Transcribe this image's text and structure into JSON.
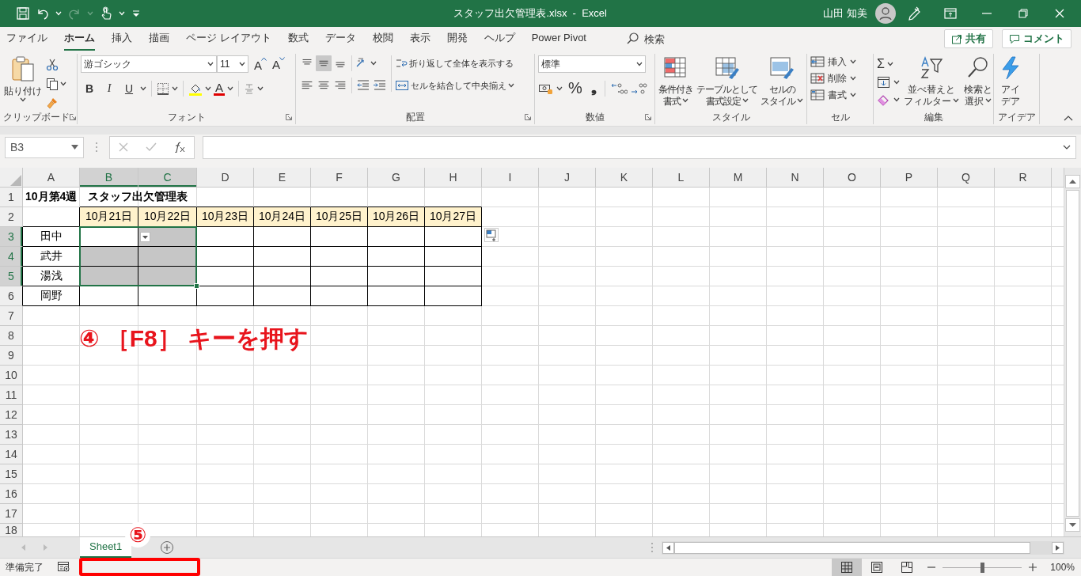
{
  "title_bar": {
    "title": "スタッフ出欠管理表.xlsx  -  Excel",
    "user": "山田 知美",
    "redo_disabled": true
  },
  "menu_tabs": [
    {
      "label": "ファイル",
      "selected": false
    },
    {
      "label": "ホーム",
      "selected": true
    },
    {
      "label": "挿入",
      "selected": false
    },
    {
      "label": "描画",
      "selected": false
    },
    {
      "label": "ページ レイアウト",
      "selected": false
    },
    {
      "label": "数式",
      "selected": false
    },
    {
      "label": "データ",
      "selected": false
    },
    {
      "label": "校閲",
      "selected": false
    },
    {
      "label": "表示",
      "selected": false
    },
    {
      "label": "開発",
      "selected": false
    },
    {
      "label": "ヘルプ",
      "selected": false
    },
    {
      "label": "Power Pivot",
      "selected": false
    }
  ],
  "search": {
    "placeholder": "検索"
  },
  "share_button": "共有",
  "comment_button": "コメント",
  "ribbon": [
    {
      "kind": "clipboard",
      "label": "クリップボード",
      "paste": "貼り付け"
    },
    {
      "kind": "font",
      "label": "フォント",
      "font_name": "游ゴシック",
      "font_size": "11",
      "grow": "A",
      "shrink": "A",
      "styles": [
        "B",
        "I",
        "U"
      ],
      "font_color": "A"
    },
    {
      "kind": "alignment",
      "label": "配置",
      "align_buttons": [
        {
          "kind": "top",
          "selected": false
        },
        {
          "kind": "middle",
          "selected": true
        },
        {
          "kind": "bottom",
          "selected": false
        }
      ],
      "wrap": "折り返して全体を表示する",
      "merge": "セルを結合して中央揃え"
    },
    {
      "kind": "number",
      "label": "数値",
      "format": "標準",
      "percent": "%",
      "comma": "❟"
    },
    {
      "kind": "styles",
      "label": "スタイル",
      "buttons": [
        {
          "kind": "conditional",
          "lines": [
            "条件付き",
            "書式"
          ]
        },
        {
          "kind": "table",
          "lines": [
            "テーブルとして",
            "書式設定"
          ]
        },
        {
          "kind": "cell",
          "lines": [
            "セルの",
            "スタイル"
          ]
        }
      ]
    },
    {
      "kind": "cells",
      "label": "セル",
      "buttons": [
        {
          "kind": "insert",
          "label": "挿入"
        },
        {
          "kind": "delete",
          "label": "削除"
        },
        {
          "kind": "format",
          "label": "書式"
        }
      ]
    },
    {
      "kind": "editing",
      "label": "編集",
      "sum": "Σ",
      "buttons": [
        {
          "kind": "sort",
          "lines": [
            "並べ替えと",
            "フィルター"
          ]
        },
        {
          "kind": "find",
          "lines": [
            "検索と",
            "選択"
          ]
        }
      ]
    },
    {
      "kind": "ideas",
      "label": "アイデア",
      "lines": [
        "アイ",
        "デア"
      ]
    }
  ],
  "formula_bar": {
    "name_box": "B3"
  },
  "sheet": {
    "columns": [
      {
        "label": "A",
        "selected": false
      },
      {
        "label": "B",
        "selected": true
      },
      {
        "label": "C",
        "selected": true
      },
      {
        "label": "D",
        "selected": false
      },
      {
        "label": "E",
        "selected": false
      },
      {
        "label": "F",
        "selected": false
      },
      {
        "label": "G",
        "selected": false
      },
      {
        "label": "H",
        "selected": false
      },
      {
        "label": "I",
        "selected": false
      },
      {
        "label": "J",
        "selected": false
      },
      {
        "label": "K",
        "selected": false
      },
      {
        "label": "L",
        "selected": false
      },
      {
        "label": "M",
        "selected": false
      },
      {
        "label": "N",
        "selected": false
      },
      {
        "label": "O",
        "selected": false
      },
      {
        "label": "P",
        "selected": false
      },
      {
        "label": "Q",
        "selected": false
      },
      {
        "label": "R",
        "selected": false
      }
    ],
    "rows": [
      {
        "label": "1",
        "selected": false,
        "cells": [
          {
            "text": "10月第4週　スタッフ出欠管理表",
            "kind": "title",
            "selected": false
          }
        ]
      },
      {
        "label": "2",
        "selected": false,
        "cells": [
          {
            "kind": "empty",
            "selected": false
          },
          {
            "text": "10月21日",
            "kind": "date",
            "selected": false
          },
          {
            "text": "10月22日",
            "kind": "date",
            "selected": false
          },
          {
            "text": "10月23日",
            "kind": "date",
            "selected": false
          },
          {
            "text": "10月24日",
            "kind": "date",
            "selected": false
          },
          {
            "text": "10月25日",
            "kind": "date",
            "selected": false
          },
          {
            "text": "10月26日",
            "kind": "date",
            "selected": false
          },
          {
            "text": "10月27日",
            "kind": "date",
            "selected": false
          }
        ]
      },
      {
        "label": "3",
        "selected": true,
        "cells": [
          {
            "text": "田中",
            "kind": "name",
            "selected": false
          },
          {
            "kind": "blank",
            "selected": true
          },
          {
            "kind": "blank",
            "selected": true
          },
          {
            "kind": "blank",
            "selected": false
          },
          {
            "kind": "blank",
            "selected": false
          },
          {
            "kind": "blank",
            "selected": false
          },
          {
            "kind": "blank",
            "selected": false
          },
          {
            "kind": "blank",
            "selected": false
          }
        ]
      },
      {
        "label": "4",
        "selected": true,
        "cells": [
          {
            "text": "武井",
            "kind": "name",
            "selected": false
          },
          {
            "kind": "blank",
            "selected": true
          },
          {
            "kind": "blank",
            "selected": true
          },
          {
            "kind": "blank",
            "selected": false
          },
          {
            "kind": "blank",
            "selected": false
          },
          {
            "kind": "blank",
            "selected": false
          },
          {
            "kind": "blank",
            "selected": false
          },
          {
            "kind": "blank",
            "selected": false
          }
        ]
      },
      {
        "label": "5",
        "selected": true,
        "cells": [
          {
            "text": "湯浅",
            "kind": "name",
            "selected": false
          },
          {
            "kind": "blank",
            "selected": true
          },
          {
            "kind": "blank",
            "selected": true
          },
          {
            "kind": "blank",
            "selected": false
          },
          {
            "kind": "blank",
            "selected": false
          },
          {
            "kind": "blank",
            "selected": false
          },
          {
            "kind": "blank",
            "selected": false
          },
          {
            "kind": "blank",
            "selected": false
          }
        ]
      },
      {
        "label": "6",
        "selected": false,
        "cells": [
          {
            "text": "岡野",
            "kind": "name",
            "selected": false
          },
          {
            "kind": "blank",
            "selected": false
          },
          {
            "kind": "blank",
            "selected": false
          },
          {
            "kind": "blank",
            "selected": false
          },
          {
            "kind": "blank",
            "selected": false
          },
          {
            "kind": "blank",
            "selected": false
          },
          {
            "kind": "blank",
            "selected": false
          },
          {
            "kind": "blank",
            "selected": false
          }
        ]
      },
      {
        "label": "7",
        "selected": false
      },
      {
        "label": "8",
        "selected": false
      },
      {
        "label": "9",
        "selected": false
      },
      {
        "label": "10",
        "selected": false
      },
      {
        "label": "11",
        "selected": false
      },
      {
        "label": "12",
        "selected": false
      },
      {
        "label": "13",
        "selected": false
      },
      {
        "label": "14",
        "selected": false
      },
      {
        "label": "15",
        "selected": false
      },
      {
        "label": "16",
        "selected": false
      },
      {
        "label": "17",
        "selected": false
      },
      {
        "label": "18",
        "selected": false
      }
    ]
  },
  "sheet_tabs": [
    {
      "label": "Sheet1",
      "selected": true
    }
  ],
  "status_bar": {
    "mode": "準備完了",
    "views": [
      {
        "kind": "normal",
        "selected": true
      },
      {
        "kind": "page-layout",
        "selected": false
      },
      {
        "kind": "page-break",
        "selected": false
      }
    ],
    "zoom": {
      "level": 0.5,
      "reading": "100%"
    }
  },
  "annotations": [
    {
      "kind": "callout",
      "text": "④ ［F8］ キーを押す"
    },
    {
      "kind": "step-badge",
      "text": "⑤"
    },
    {
      "kind": "highlight-box"
    }
  ]
}
